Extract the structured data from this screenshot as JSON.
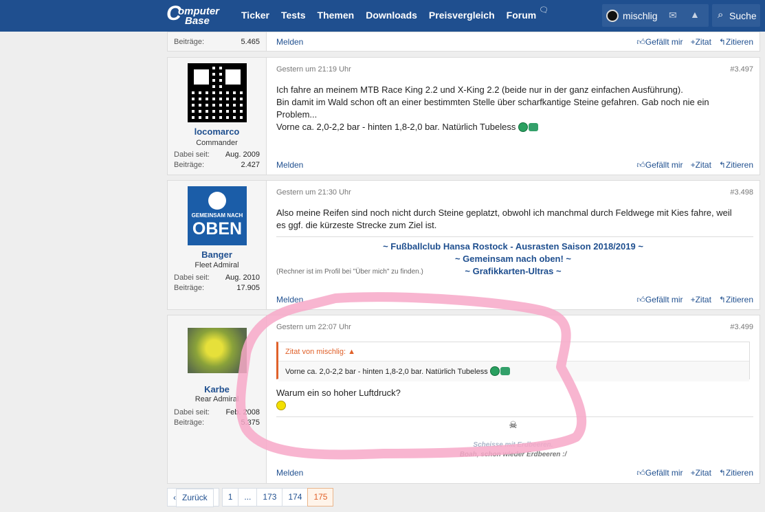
{
  "nav": {
    "logo_line1": "omputer",
    "logo_line2": "Base",
    "logo_letter": "C",
    "items": [
      "Ticker",
      "Tests",
      "Themen",
      "Downloads",
      "Preisvergleich",
      "Forum"
    ],
    "username": "mischlig",
    "search_label": "Suche"
  },
  "posts": [
    {
      "stats": [
        {
          "label": "Beiträge:",
          "value": "5.465"
        }
      ],
      "melden": "Melden",
      "actions": [
        "Gefällt mir",
        "Zitat",
        "Zitieren"
      ]
    },
    {
      "author": "locomarco",
      "rank": "Commander",
      "stats": [
        {
          "label": "Dabei seit:",
          "value": "Aug. 2009"
        },
        {
          "label": "Beiträge:",
          "value": "2.427"
        }
      ],
      "date": "Gestern um 21:19 Uhr",
      "number": "#3.497",
      "body": [
        "Ich fahre an meinem MTB Race King 2.2 und X-King 2.2 (beide nur in der ganz einfachen Ausführung).",
        "Bin damit im Wald schon oft an einer bestimmten Stelle über scharfkantige Steine gefahren. Gab noch nie ein",
        "Problem...",
        "Vorne ca. 2,0-2,2 bar - hinten 1,8-2,0 bar. Natürlich Tubeless"
      ],
      "melden": "Melden",
      "actions": [
        "Gefällt mir",
        "Zitat",
        "Zitieren"
      ]
    },
    {
      "author": "Banger",
      "rank": "Fleet Admiral",
      "stats": [
        {
          "label": "Dabei seit:",
          "value": "Aug. 2010"
        },
        {
          "label": "Beiträge:",
          "value": "17.905"
        }
      ],
      "avatar_text": [
        "GEMEINSAM NACH",
        "OBEN"
      ],
      "date": "Gestern um 21:30 Uhr",
      "number": "#3.498",
      "body": [
        "Also meine Reifen sind noch nicht durch Steine geplatzt, obwohl ich manchmal durch Feldwege mit Kies fahre, weil",
        "es ggf. die kürzeste Strecke zum Ziel ist."
      ],
      "signature": [
        "~ Fußballclub Hansa Rostock - Ausrasten Saison 2018/2019 ~",
        "~ Gemeinsam nach oben! ~",
        "~ Grafikkarten-Ultras ~"
      ],
      "sig_note": "(Rechner ist im Profil bei \"Über mich\" zu finden.)",
      "melden": "Melden",
      "actions": [
        "Gefällt mir",
        "Zitat",
        "Zitieren"
      ]
    },
    {
      "author": "Karbe",
      "rank": "Rear Admiral",
      "stats": [
        {
          "label": "Dabei seit:",
          "value": "Feb. 2008"
        },
        {
          "label": "Beiträge:",
          "value": "5.375"
        }
      ],
      "date": "Gestern um 22:07 Uhr",
      "number": "#3.499",
      "quote_header": "Zitat von mischlig:",
      "quote_text": "Vorne ca. 2,0-2,2 bar - hinten 1,8-2,0 bar. Natürlich Tubeless",
      "body": [
        "Warum ein so hoher Luftdruck?"
      ],
      "signature": [
        "Scheisse mit Erdbeeren.",
        "Boah, schon wieder Erdbeeren :/"
      ],
      "melden": "Melden",
      "actions": [
        "Gefällt mir",
        "Zitat",
        "Zitieren"
      ]
    }
  ],
  "pagination": {
    "back": "Zurück",
    "pages": [
      "1",
      "...",
      "173",
      "174",
      "175"
    ],
    "current": "175"
  },
  "colors": {
    "nav_bg": "#1f4f8f",
    "link": "#1f4f8f",
    "accent": "#e0612a",
    "marker": "#f7a8c8"
  }
}
